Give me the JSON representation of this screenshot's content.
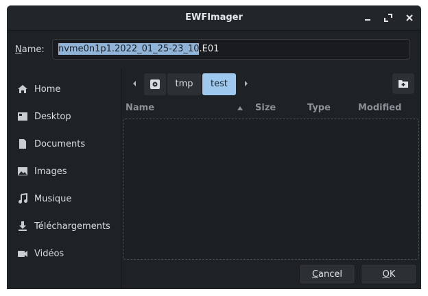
{
  "window": {
    "title": "EWFImager"
  },
  "name_field": {
    "label_underlined": "N",
    "label_rest": "ame:",
    "value_selected": "nvme0n1p1.2022_01_25-23_10",
    "value_unselected": ".E01"
  },
  "sidebar": {
    "items": [
      {
        "label": "Home",
        "icon": "home-icon"
      },
      {
        "label": "Desktop",
        "icon": "desktop-icon"
      },
      {
        "label": "Documents",
        "icon": "document-icon"
      },
      {
        "label": "Images",
        "icon": "image-icon"
      },
      {
        "label": "Musique",
        "icon": "music-icon"
      },
      {
        "label": "Téléchargements",
        "icon": "download-icon"
      },
      {
        "label": "Vidéos",
        "icon": "video-icon"
      }
    ]
  },
  "path": {
    "crumbs": [
      "tmp",
      "test"
    ],
    "active": "test"
  },
  "columns": {
    "name": "Name",
    "size": "Size",
    "type": "Type",
    "modified": "Modified"
  },
  "buttons": {
    "cancel_underlined": "C",
    "cancel_rest": "ancel",
    "ok_underlined": "O",
    "ok_rest": "K"
  },
  "colors": {
    "window_bg": "#1f2225",
    "accent": "#9fc8ee",
    "selection": "#8fb4d8"
  }
}
